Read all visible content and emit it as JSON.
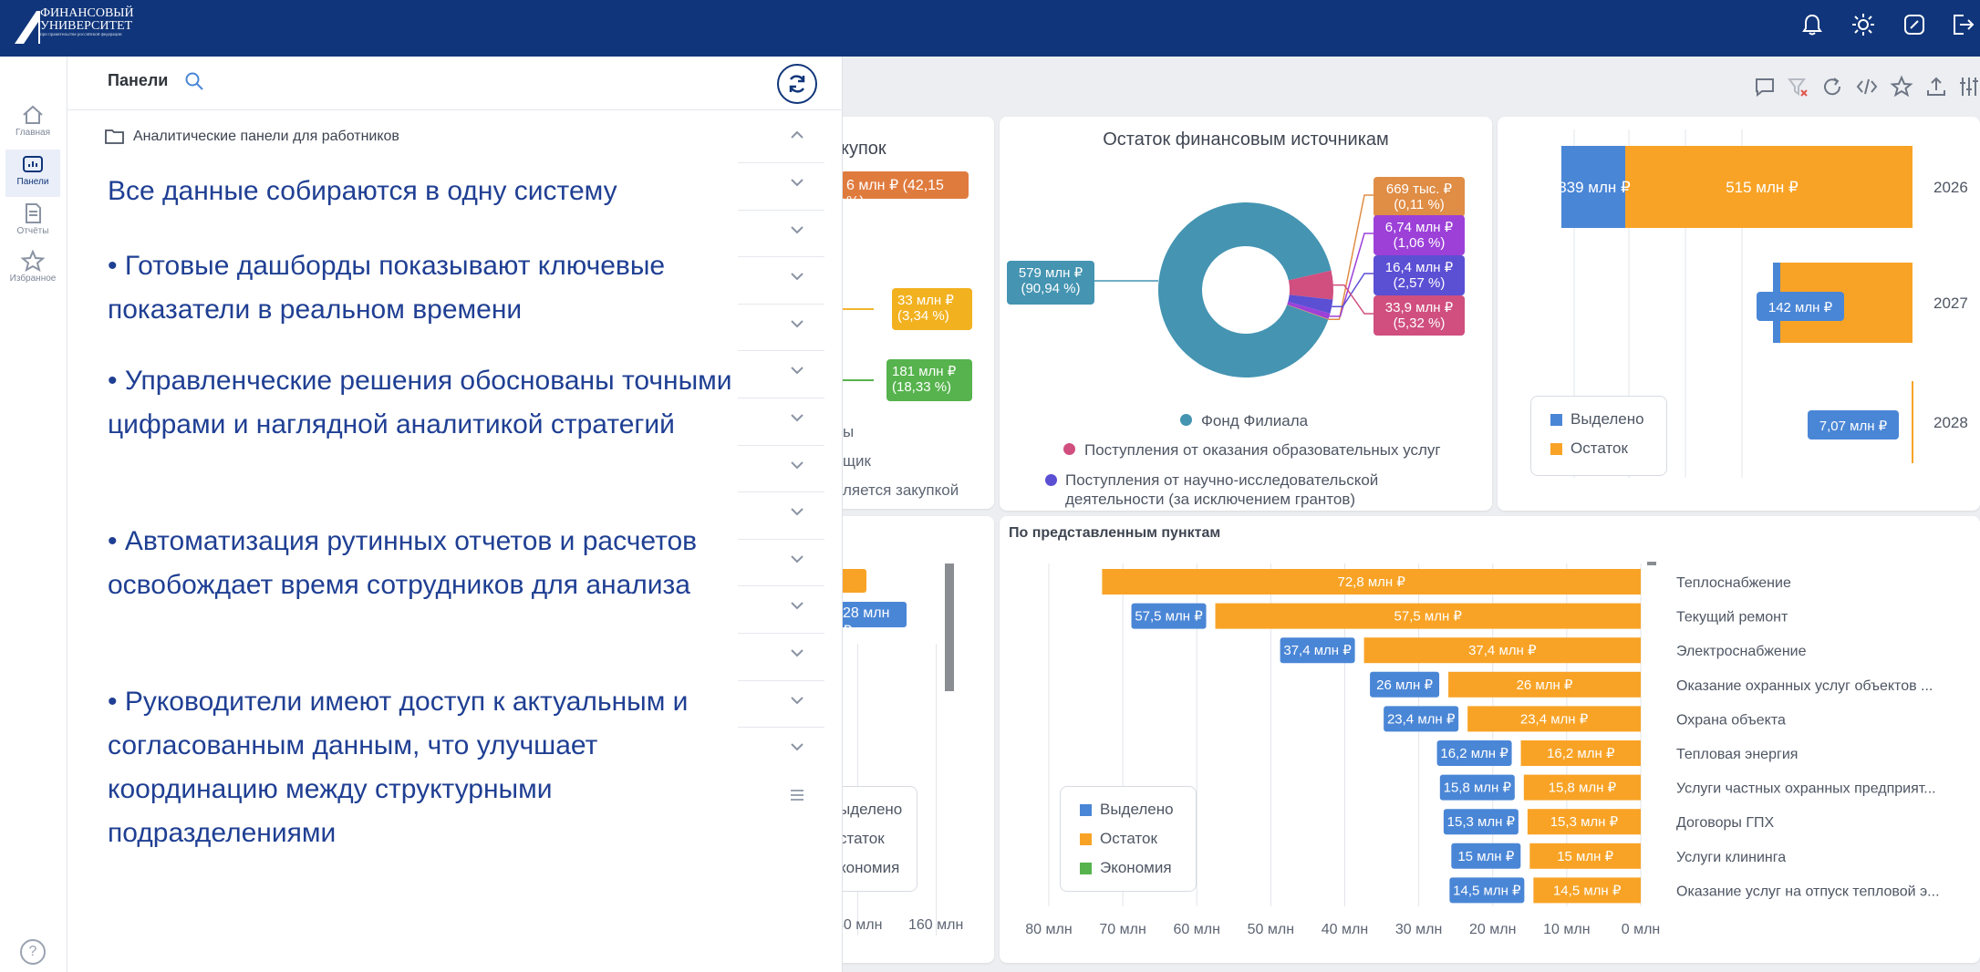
{
  "header": {
    "logo_line1": "ФИНАНСОВЫЙ",
    "logo_line2": "УНИВЕРСИТЕТ",
    "logo_tagline": "при правительстве российской федерации",
    "icons": [
      "bell-icon",
      "sun-icon",
      "edit-icon",
      "logout-icon"
    ]
  },
  "nav": {
    "home": "Главная",
    "panels": "Панели",
    "reports": "Отчёты",
    "favorites": "Избранное",
    "help": "?"
  },
  "panel": {
    "title": "Панели",
    "folder": "Аналитические панели для работников",
    "text": {
      "heading": "Все данные собираются в одну систему",
      "b1": "• Готовые дашборды показывают ключевые показатели в реальном времени",
      "b2": "• Управленческие решения обоснованы точными цифрами и наглядной аналитикой стратегий",
      "b3": "• Автоматизация рутинных отчетов и расчетов освобождает время сотрудников для анализа",
      "b4": "• Руководители имеют доступ к актуальным и согласованным данным, что улучшает координацию между структурными подразделениями"
    }
  },
  "card1_partial": {
    "title_fragment": "купок",
    "labels": [
      "6 млн ₽ (42,15 %)",
      "33 млн ₽\n(3,34 %)",
      "181 млн ₽\n(18,33 %)"
    ],
    "legend_fragments": [
      "ы",
      "щик",
      "ляется закупкой"
    ]
  },
  "card_left_bottom_partial": {
    "bar_labels": [
      "28 млн ₽"
    ],
    "axis": [
      "40 млн",
      "160 млн"
    ],
    "legend_fragments": [
      "ыделено",
      "статок",
      "кономия"
    ]
  },
  "chart_data": [
    {
      "type": "pie",
      "title": "Остаток финансовым источникам",
      "slices": [
        {
          "name": "Фонд Филиала",
          "value": 579,
          "label": "579 млн ₽\n(90,94 %)",
          "color": "#4494b2"
        },
        {
          "name": "Поступления от оказания образовательных услуг",
          "value": 33.9,
          "label": "33,9 млн ₽\n(5,32 %)",
          "color": "#d04f7f"
        },
        {
          "name": "Поступления от научно-исследовательской деятельности (за исключением грантов)",
          "value": 16.4,
          "label": "16,4 млн ₽\n(2,57 %)",
          "color": "#5b4fd4"
        },
        {
          "name": "",
          "value": 6.74,
          "label": "6,74 млн ₽\n(1,06 %)",
          "color": "#9c40d8"
        },
        {
          "name": "",
          "value": 0.669,
          "label": "669 тыс. ₽\n(0,11 %)",
          "color": "#e08d45"
        }
      ],
      "legend": [
        "Фонд Филиала",
        "Поступления от оказания образовательных услуг",
        "Поступления от научно-исследовательской\nдеятельности (за исключением грантов)"
      ]
    },
    {
      "type": "bar",
      "orientation": "horizontal",
      "categories": [
        "2026",
        "2027",
        "2028"
      ],
      "series": [
        {
          "name": "Выделено",
          "color": "#4a86d6",
          "values": [
            839,
            142,
            7.07
          ],
          "labels": [
            "839 млн ₽",
            "142 млн ₽",
            "7,07 млн ₽"
          ]
        },
        {
          "name": "Остаток",
          "color": "#f8a326",
          "values": [
            515,
            60,
            3
          ],
          "labels": [
            "515 млн ₽",
            "",
            ""
          ]
        }
      ],
      "legend": [
        "Выделено",
        "Остаток"
      ]
    },
    {
      "type": "bar",
      "orientation": "horizontal",
      "title": "По представленным пунктам",
      "categories": [
        "Теплоснабжение",
        "Текущий ремонт",
        "Электроснабжение",
        "Оказание охранных услуг объектов ...",
        "Охрана объекта",
        "Тепловая энергия",
        "Услуги частных охранных предприят...",
        "Договоры ГПХ",
        "Услуги клининга",
        "Оказание услуг на отпуск тепловой э..."
      ],
      "series": [
        {
          "name": "Выделено",
          "color": "#4a86d6",
          "values": [
            null,
            57.5,
            37.4,
            26,
            23.4,
            16.2,
            15.8,
            15.3,
            15,
            14.5
          ],
          "labels": [
            "",
            "57,5 млн ₽",
            "37,4 млн ₽",
            "26 млн ₽",
            "23,4 млн ₽",
            "16,2 млн ₽",
            "15,8 млн ₽",
            "15,3 млн ₽",
            "15 млн ₽",
            "14,5 млн ₽"
          ]
        },
        {
          "name": "Остаток",
          "color": "#f8a326",
          "values": [
            72.8,
            57.5,
            37.4,
            26,
            23.4,
            16.2,
            15.8,
            15.3,
            15,
            14.5
          ],
          "labels": [
            "72,8 млн ₽",
            "57,5 млн ₽",
            "37,4 млн ₽",
            "26 млн ₽",
            "23,4 млн ₽",
            "16,2 млн ₽",
            "15,8 млн ₽",
            "15,3 млн ₽",
            "15 млн ₽",
            "14,5 млн ₽"
          ]
        }
      ],
      "x_ticks": [
        "80 млн",
        "70 млн",
        "60 млн",
        "50 млн",
        "40 млн",
        "30 млн",
        "20 млн",
        "10 млн",
        "0 млн"
      ],
      "xlim": [
        80,
        0
      ],
      "legend": [
        "Выделено",
        "Остаток",
        "Экономия"
      ],
      "legend_colors": [
        "#4a86d6",
        "#f8a326",
        "#56b34d"
      ]
    }
  ]
}
